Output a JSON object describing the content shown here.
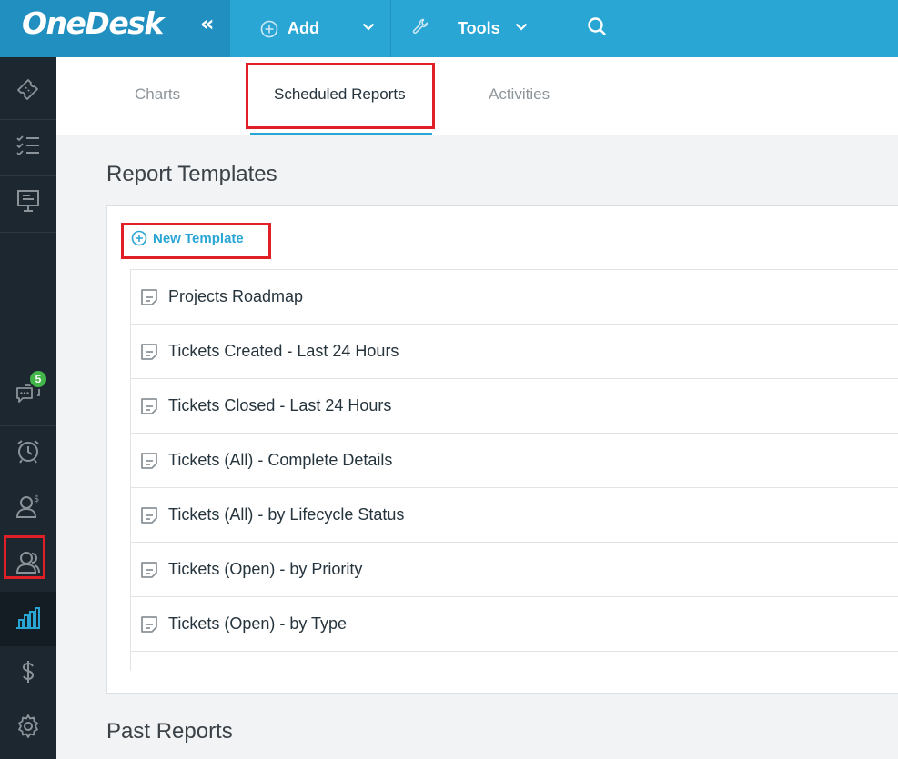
{
  "brand": {
    "logo": "OneDesk",
    "collapse": "«"
  },
  "topnav": {
    "add_label": "Add",
    "tools_label": "Tools"
  },
  "sidebar": {
    "icons": [
      "tickets-icon",
      "tasks-icon",
      "projects-board-icon",
      "messages-icon",
      "timer-icon",
      "customers-icon",
      "users-icon",
      "reports-icon",
      "billing-icon",
      "settings-icon"
    ],
    "messages_badge": "5",
    "active": "reports-icon"
  },
  "tabs": [
    {
      "label": "Charts"
    },
    {
      "label": "Scheduled Reports"
    },
    {
      "label": "Activities"
    }
  ],
  "report_templates": {
    "title": "Report Templates",
    "new_template_label": "New Template",
    "items": [
      "Projects Roadmap",
      "Tickets Created - Last 24 Hours",
      "Tickets Closed - Last 24 Hours",
      "Tickets (All) - Complete Details",
      "Tickets (All) - by Lifecycle Status",
      "Tickets (Open) - by Priority",
      "Tickets (Open) - by Type"
    ]
  },
  "past_reports": {
    "title": "Past Reports"
  },
  "colors": {
    "accent": "#2aa6d5",
    "sidebar": "#1d2730",
    "highlight": "#e11f26",
    "badge": "#43b649"
  }
}
